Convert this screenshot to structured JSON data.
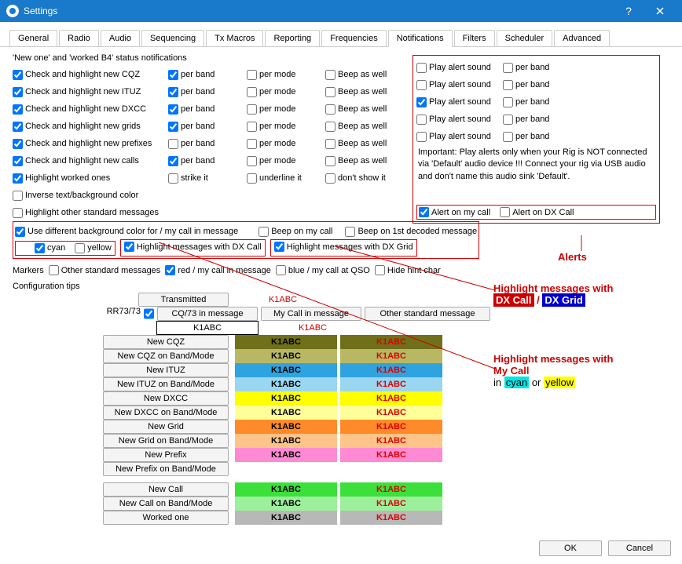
{
  "window": {
    "title": "Settings"
  },
  "tabs": [
    "General",
    "Radio",
    "Audio",
    "Sequencing",
    "Tx Macros",
    "Reporting",
    "Frequencies",
    "Notifications",
    "Filters",
    "Scheduler",
    "Advanced"
  ],
  "section_title": "'New one' and 'worked B4' status notifications",
  "rows": [
    {
      "label": "Check and highlight new CQZ",
      "c1": true,
      "perband": true,
      "permode": false,
      "beep": false,
      "alert_sound": false,
      "alert_band": false
    },
    {
      "label": "Check and highlight new ITUZ",
      "c1": true,
      "perband": true,
      "permode": false,
      "beep": false,
      "alert_sound": false,
      "alert_band": false
    },
    {
      "label": "Check and highlight new DXCC",
      "c1": true,
      "perband": true,
      "permode": false,
      "beep": false,
      "alert_sound": true,
      "alert_band": false
    },
    {
      "label": "Check and highlight new grids",
      "c1": true,
      "perband": true,
      "permode": false,
      "beep": false,
      "alert_sound": false,
      "alert_band": false
    },
    {
      "label": "Check and highlight new prefixes",
      "c1": true,
      "perband": false,
      "permode": false,
      "beep": false,
      "alert_sound": false,
      "alert_band": false
    },
    {
      "label": "Check and highlight new calls",
      "c1": true,
      "perband": true,
      "permode": false,
      "beep": false
    }
  ],
  "col_labels": {
    "perband": "per band",
    "permode": "per mode",
    "beep": "Beep as well",
    "alert": "Play alert sound"
  },
  "highlight_worked": {
    "label": "Highlight worked ones",
    "checked": true,
    "strike": "strike it",
    "underline": "underline it",
    "dont": "don't show it"
  },
  "inverse": {
    "label": "Inverse text/background color",
    "checked": false
  },
  "other_std": {
    "label": "Highlight other standard messages",
    "checked": false
  },
  "diff_bg": {
    "label": "Use different background color for / my call in message",
    "checked": true,
    "cyan": "cyan",
    "cyan_checked": true,
    "yellow": "yellow",
    "yellow_checked": false,
    "hl_dxcall": "Highlight messages with DX Call",
    "hl_dxcall_checked": true,
    "hl_dxgrid": "Highlight messages with DX Grid",
    "hl_dxgrid_checked": true
  },
  "beep_mycall": {
    "label": "Beep on my call",
    "checked": false
  },
  "beep_first": {
    "label": "Beep on 1st decoded message",
    "checked": false
  },
  "alert_mycall": {
    "label": "Alert on my call",
    "checked": true
  },
  "alert_dxcall": {
    "label": "Alert on DX Call",
    "checked": false
  },
  "important": "Important: Play alerts only when your Rig is NOT connected via 'Default' audio device !!! Connect your rig via USB audio and don't name this audio sink 'Default'.",
  "markers": {
    "title": "Markers",
    "other": "Other standard messages",
    "red": "red / my call in message",
    "red_checked": true,
    "blue": "blue / my call at QSO",
    "hide": "Hide hint char"
  },
  "config_tips": "Configuration tips",
  "headers": {
    "tx": "Transmitted message",
    "cq": "CQ/73 in message",
    "mycall": "My Call in message",
    "other": "Other standard message"
  },
  "rr": {
    "label": "RR73/73",
    "checked": true
  },
  "sample": "K1ABC",
  "color_rows": [
    {
      "label": "New CQZ",
      "bg1": "#70701a",
      "fg1": "#000",
      "bg2": "#70701a",
      "fg2": "#d00"
    },
    {
      "label": "New CQZ on Band/Mode",
      "bg1": "#b8b864",
      "fg1": "#000",
      "bg2": "#b8b864",
      "fg2": "#d00"
    },
    {
      "label": "New ITUZ",
      "bg1": "#2fa3e0",
      "fg1": "#000",
      "bg2": "#2fa3e0",
      "fg2": "#d00"
    },
    {
      "label": "New ITUZ on Band/Mode",
      "bg1": "#9ad6f0",
      "fg1": "#000",
      "bg2": "#9ad6f0",
      "fg2": "#d00"
    },
    {
      "label": "New DXCC",
      "bg1": "#ffff00",
      "fg1": "#000",
      "bg2": "#ffff00",
      "fg2": "#d00"
    },
    {
      "label": "New DXCC on Band/Mode",
      "bg1": "#ffff99",
      "fg1": "#000",
      "bg2": "#ffff99",
      "fg2": "#d00"
    },
    {
      "label": "New Grid",
      "bg1": "#ff8a2a",
      "fg1": "#000",
      "bg2": "#ff8a2a",
      "fg2": "#d00"
    },
    {
      "label": "New Grid on Band/Mode",
      "bg1": "#ffc488",
      "fg1": "#000",
      "bg2": "#ffc488",
      "fg2": "#d00"
    },
    {
      "label": "New Prefix",
      "bg1": "#ff8ad4",
      "fg1": "#000",
      "bg2": "#ff8ad4",
      "fg2": "#d00"
    },
    {
      "label": "New Prefix on Band/Mode",
      "bg1": "",
      "fg1": "",
      "bg2": "",
      "fg2": ""
    },
    {
      "label": "New Call",
      "bg1": "#3be03b",
      "fg1": "#000",
      "bg2": "#3be03b",
      "fg2": "#d00"
    },
    {
      "label": "New Call on Band/Mode",
      "bg1": "#9cf09c",
      "fg1": "#000",
      "bg2": "#9cf09c",
      "fg2": "#d00"
    },
    {
      "label": "Worked one",
      "bg1": "#b8b8b8",
      "fg1": "#000",
      "bg2": "#b8b8b8",
      "fg2": "#d00"
    }
  ],
  "buttons": {
    "ok": "OK",
    "cancel": "Cancel"
  },
  "annotations": {
    "alerts": "Alerts",
    "hl_dx_title": "Highlight messages with",
    "dxcall": "DX Call",
    "dxgrid": "DX Grid",
    "slash": " / ",
    "hl_my_title": "Highlight messages with",
    "mycall": "My Call",
    "in": "in ",
    "or": "  or  ",
    "cyan": "cyan",
    "yellow": "yellow"
  }
}
